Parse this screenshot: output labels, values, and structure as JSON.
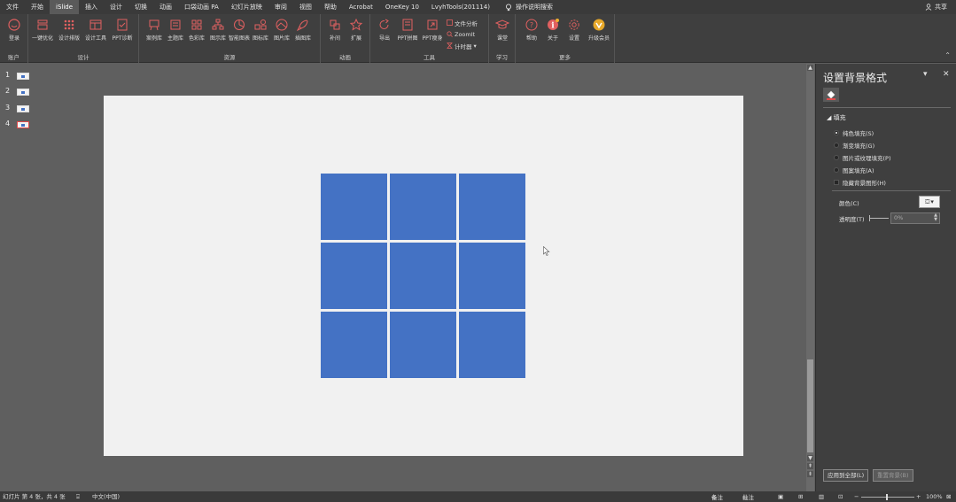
{
  "tabs": [
    "文件",
    "开始",
    "iSlide",
    "插入",
    "设计",
    "切换",
    "动画",
    "口袋动画 PA",
    "幻灯片放映",
    "审阅",
    "视图",
    "帮助",
    "Acrobat",
    "OneKey 10",
    "LvyhTools(201114)"
  ],
  "active_tab": "iSlide",
  "help_search": "操作说明搜索",
  "share_label": "共享",
  "ribbon": {
    "groups": {
      "account": "账户",
      "design": "设计",
      "resources": "资源",
      "animation": "动画",
      "tools": "工具",
      "learn": "学习",
      "more": "更多"
    },
    "buttons": {
      "login": "登录",
      "one_click": "一键优化",
      "design_layout": "设计排版",
      "design_tools": "设计工具",
      "ppt_diagnose": "PPT诊断",
      "case_lib": "案例库",
      "theme_lib": "主题库",
      "color_lib": "色彩库",
      "icon_lib": "图示库",
      "chart_lib": "智能图表",
      "icon_lib2": "图标库",
      "image_lib": "图片库",
      "illus_lib": "插图库",
      "tween": "补间",
      "expand": "扩展",
      "export": "导出",
      "ppt_collage": "PPT拼图",
      "ppt_slim": "PPT瘦身",
      "file_analysis": "文件分析",
      "zoomit": "ZoomIt",
      "timer": "计时器",
      "class": "课堂",
      "help": "帮助",
      "about": "关于",
      "settings": "设置",
      "upgrade": "升级会员"
    }
  },
  "slides": [
    {
      "num": "1"
    },
    {
      "num": "2"
    },
    {
      "num": "3"
    },
    {
      "num": "4"
    }
  ],
  "selected_slide": "4",
  "colors": {
    "tile": "#4472c4",
    "slide_bg": "#f1f1f1",
    "accent_red": "#e04b4b"
  },
  "pane": {
    "title": "设置背景格式",
    "fill_section": "填充",
    "options": [
      "纯色填充(S)",
      "渐变填充(G)",
      "图片或纹理填充(P)",
      "图案填充(A)"
    ],
    "selected_option": "纯色填充(S)",
    "hide_bg": "隐藏背景图形(H)",
    "color_label": "颜色(C)",
    "transparency_label": "透明度(T)",
    "transparency_value": "0%",
    "apply_all": "应用到全部(L)",
    "reset_bg": "重置背景(B)"
  },
  "status": {
    "slide_info": "幻灯片 第 4 张，共 4 张",
    "language": "中文(中国)",
    "notes": "备注",
    "comments": "批注",
    "zoom": "100%"
  }
}
